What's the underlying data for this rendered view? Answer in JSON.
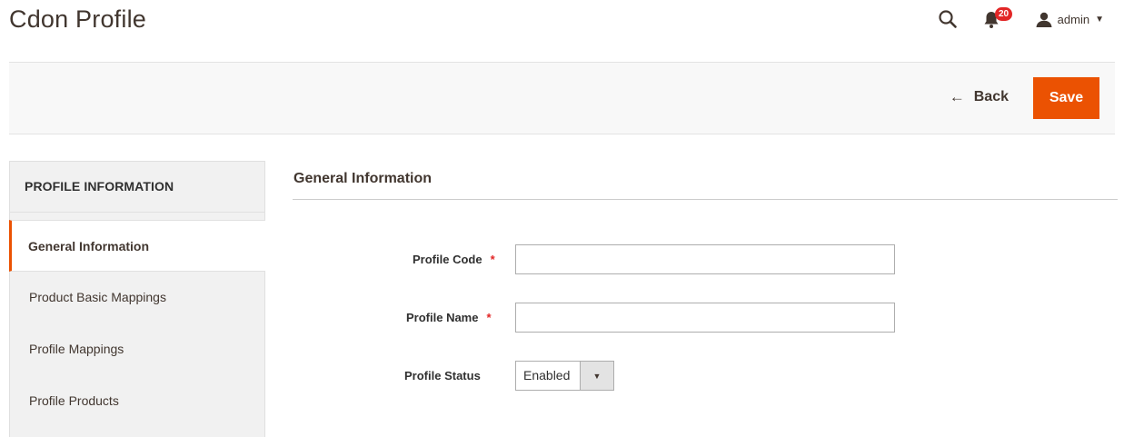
{
  "header": {
    "title": "Cdon Profile",
    "notifications_count": "20",
    "user_name": "admin"
  },
  "action_bar": {
    "back_label": "Back",
    "save_label": "Save"
  },
  "sidebar": {
    "title": "PROFILE INFORMATION",
    "tabs": [
      {
        "label": "General Information",
        "active": true
      },
      {
        "label": "Product Basic Mappings",
        "active": false
      },
      {
        "label": "Profile Mappings",
        "active": false
      },
      {
        "label": "Profile Products",
        "active": false
      }
    ]
  },
  "form": {
    "section_title": "General Information",
    "fields": {
      "profile_code": {
        "label": "Profile Code",
        "value": "",
        "required": true
      },
      "profile_name": {
        "label": "Profile Name",
        "value": "",
        "required": true
      },
      "profile_status": {
        "label": "Profile Status",
        "value": "Enabled"
      }
    },
    "required_mark": "*"
  },
  "colors": {
    "accent": "#eb5202",
    "badge": "#e22626",
    "sidebar_bg": "#f1f1f1",
    "action_bar_bg": "#f8f8f8"
  },
  "icons": {
    "search": "search-icon",
    "notifications": "bell-icon",
    "user": "user-icon",
    "back": "arrow-left-icon",
    "dropdown": "chevron-down-icon"
  }
}
